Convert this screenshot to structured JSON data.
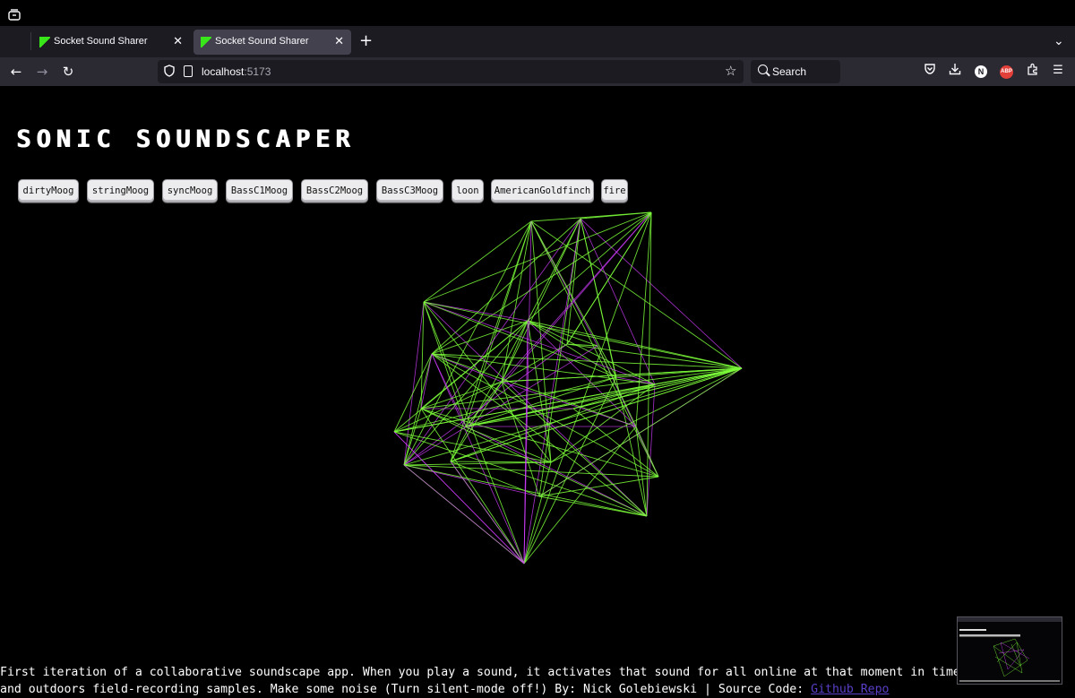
{
  "browser": {
    "tabs": [
      {
        "title": "Socket Sound Sharer",
        "active": false
      },
      {
        "title": "Socket Sound Sharer",
        "active": true
      }
    ],
    "url_host": "localhost",
    "url_port": ":5173",
    "search_placeholder": "Search",
    "account_initial": "N",
    "adblock_label": "ABP",
    "icons": [
      "tab-list-icon",
      "close-icon",
      "plus-icon",
      "chevron-down-icon",
      "back-arrow-icon",
      "forward-arrow-icon",
      "reload-icon",
      "shield-icon",
      "page-icon",
      "star-icon",
      "search-icon",
      "pocket-icon",
      "download-icon",
      "account-icon",
      "adblock-icon",
      "extensions-icon",
      "menu-icon"
    ]
  },
  "page": {
    "title": "SONIC SOUNDSCAPER",
    "sounds": [
      "dirtyMoog",
      "stringMoog",
      "syncMoog",
      "BassC1Moog",
      "BassC2Moog",
      "BassC3Moog",
      "loon",
      "AmericanGoldfinch",
      "fire"
    ],
    "footer_line1": "First iteration of a collaborative soundscape app. When you play a sound, it activates that sound for all online at that moment in time.",
    "footer_line2": "and outdoors field-recording samples. Make some noise (Turn silent-mode off!) By: Nick Golebiewski | Source Code:",
    "footer_link": "Github Repo"
  },
  "colors": {
    "background": "#000000",
    "line_green": "#7dff3a",
    "line_magenta": "#d23cff",
    "link": "#5a3ec8",
    "chrome_dark": "#1c1b22",
    "chrome_mid": "#2b2a33",
    "active_tab": "#42414d"
  }
}
